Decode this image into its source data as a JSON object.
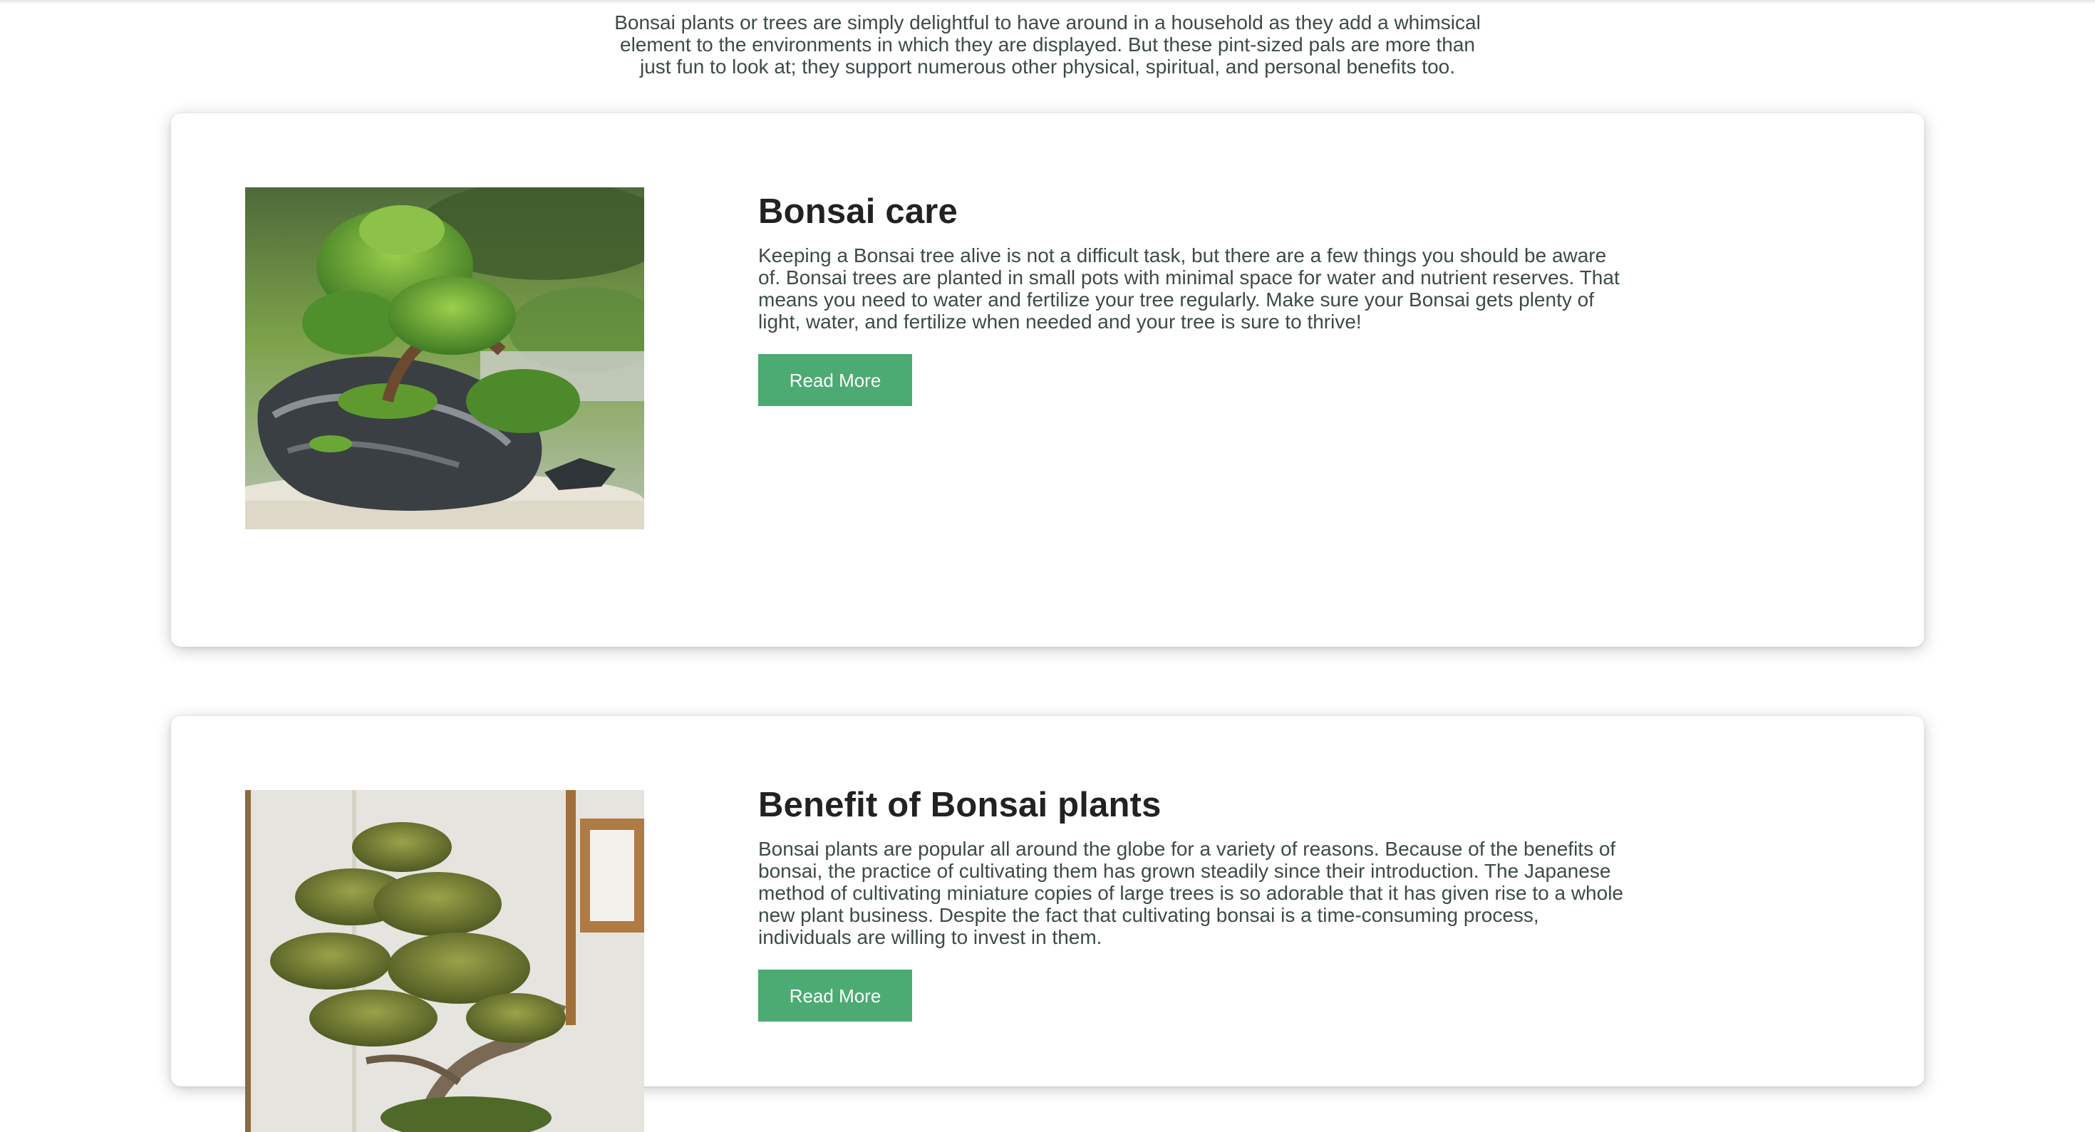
{
  "intro": {
    "text": "Bonsai plants or trees are simply delightful to have around in a household as they add a whimsical element to the environments in which they are displayed. But these pint-sized pals are more than just fun to look at; they support numerous other physical, spiritual, and personal benefits too."
  },
  "cards": [
    {
      "title": "Bonsai care",
      "body": "Keeping a Bonsai tree alive is not a difficult task, but there are a few things you should be aware of. Bonsai trees are planted in small pots with minimal space for water and nutrient reserves. That means you need to water and fertilize your tree regularly. Make sure your Bonsai gets plenty of light, water, and fertilize when needed and your tree is sure to thrive!",
      "button_label": "Read More"
    },
    {
      "title": "Benefit of Bonsai plants",
      "body": "Bonsai plants are popular all around the globe for a variety of reasons. Because of the benefits of bonsai, the practice of cultivating them has grown steadily since their introduction. The Japanese method of cultivating miniature copies of large trees is so adorable that it has given rise to a whole new plant business. Despite the fact that cultivating bonsai is a time-consuming process, individuals are willing to invest in them.",
      "button_label": "Read More"
    }
  ],
  "colors": {
    "button": "#4caa73",
    "heading": "#222222",
    "text": "#3d4a4a"
  }
}
